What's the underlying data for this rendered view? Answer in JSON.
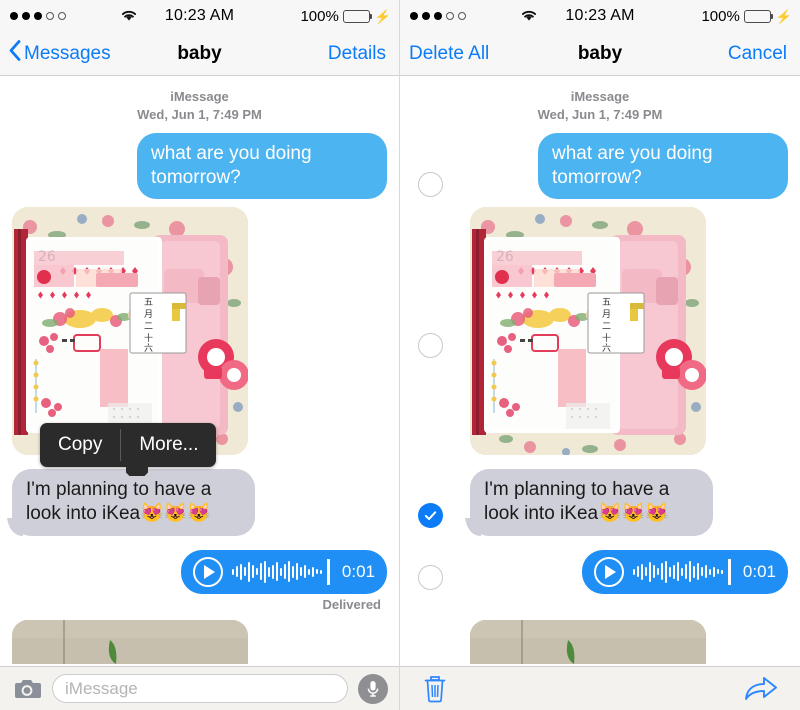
{
  "status_bar": {
    "signal_dots_filled": 3,
    "signal_dots_total": 5,
    "wifi_icon": "wifi-icon",
    "time": "10:23 AM",
    "battery_percent": "100%",
    "battery_level": 100,
    "charging_icon": "lightning-bolt-icon",
    "battery_color": "#4cd964"
  },
  "left_panel": {
    "nav": {
      "back_icon": "chevron-left-icon",
      "back_label": "Messages",
      "title": "baby",
      "right_label": "Details"
    },
    "thread": {
      "service": "iMessage",
      "timestamp": "Wed, Jun 1, 7:49 PM",
      "messages": [
        {
          "id": "m1",
          "type": "text",
          "side": "outgoing",
          "text": "what are you doing tomorrow?"
        },
        {
          "id": "m2",
          "type": "photo",
          "side": "incoming",
          "alt": "pink-planner-photo"
        },
        {
          "id": "m3",
          "type": "text",
          "side": "incoming",
          "text": "I'm planning to have a look into iKea😻😻😻"
        },
        {
          "id": "m4",
          "type": "audio",
          "side": "outgoing",
          "duration": "0:01",
          "play_icon": "play-icon"
        },
        {
          "id": "m5",
          "type": "photo",
          "side": "incoming",
          "alt": "partial-photo",
          "partial": true
        }
      ],
      "delivery_status": "Delivered"
    },
    "context_menu": {
      "items": [
        {
          "label": "Copy"
        },
        {
          "label": "More..."
        }
      ]
    },
    "toolbar": {
      "camera_icon": "camera-icon",
      "input_placeholder": "iMessage",
      "input_value": "",
      "mic_icon": "microphone-icon"
    }
  },
  "right_panel": {
    "nav": {
      "left_label": "Delete All",
      "title": "baby",
      "right_label": "Cancel"
    },
    "thread": {
      "service": "iMessage",
      "timestamp": "Wed, Jun 1, 7:49 PM",
      "messages": [
        {
          "id": "r1",
          "type": "text",
          "side": "outgoing",
          "text": "what are you doing tomorrow?",
          "selected": false
        },
        {
          "id": "r2",
          "type": "photo",
          "side": "incoming",
          "alt": "pink-planner-photo",
          "selected": false
        },
        {
          "id": "r3",
          "type": "text",
          "side": "incoming",
          "text": "I'm planning to have a look into iKea😻😻😻",
          "selected": true
        },
        {
          "id": "r4",
          "type": "audio",
          "side": "outgoing",
          "duration": "0:01",
          "play_icon": "play-icon",
          "selected": false
        },
        {
          "id": "r5",
          "type": "photo",
          "side": "incoming",
          "alt": "partial-photo",
          "partial": true
        }
      ]
    },
    "toolbar": {
      "delete_icon": "trash-icon",
      "forward_icon": "forward-arrow-icon"
    }
  },
  "colors": {
    "bubble_outgoing": "#4cb4f0",
    "bubble_audio": "#1f8ff5",
    "bubble_incoming": "#cfcfd9",
    "accent_blue": "#0b7bf8",
    "nav_background": "#f7f7f7",
    "toolbar_background": "#f3f2ef",
    "meta_text": "#8a8a8f"
  }
}
